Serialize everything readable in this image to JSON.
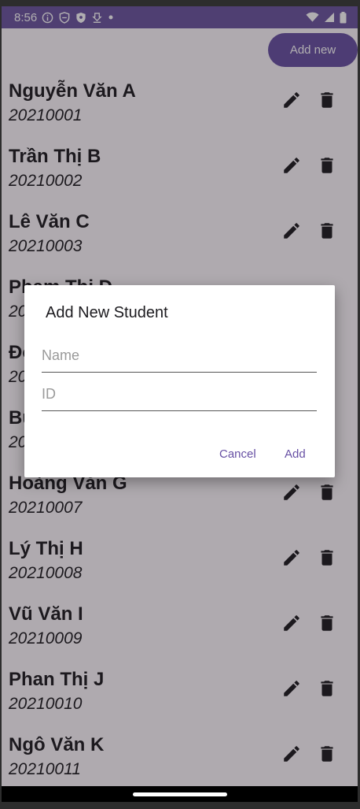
{
  "status_bar": {
    "time": "8:56",
    "icons": [
      "info-icon",
      "shield-icon",
      "shield-check-icon",
      "download-icon",
      "dot-icon",
      "wifi-icon",
      "signal-icon",
      "battery-icon"
    ]
  },
  "toolbar": {
    "add_new_label": "Add new"
  },
  "students": [
    {
      "name": "Nguyễn Văn A",
      "id": "20210001"
    },
    {
      "name": "Trần Thị B",
      "id": "20210002"
    },
    {
      "name": "Lê Văn C",
      "id": "20210003"
    },
    {
      "name": "Phạm Thị D",
      "id": "20210004"
    },
    {
      "name": "Đỗ Văn E",
      "id": "20210005"
    },
    {
      "name": "Bùi Thị F",
      "id": "20210006"
    },
    {
      "name": "Hoàng Văn G",
      "id": "20210007"
    },
    {
      "name": "Lý Thị H",
      "id": "20210008"
    },
    {
      "name": "Vũ Văn I",
      "id": "20210009"
    },
    {
      "name": "Phan Thị J",
      "id": "20210010"
    },
    {
      "name": "Ngô Văn K",
      "id": "20210011"
    }
  ],
  "dialog": {
    "title": "Add New Student",
    "name_placeholder": "Name",
    "id_placeholder": "ID",
    "cancel_label": "Cancel",
    "add_label": "Add"
  },
  "colors": {
    "primary": "#6750a4",
    "status_bar": "#6a55a0",
    "scrim": "rgba(30,22,30,0.35)"
  }
}
